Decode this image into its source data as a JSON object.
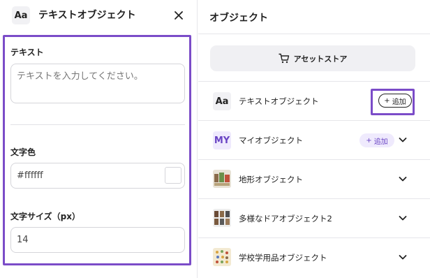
{
  "left_panel": {
    "icon_text": "Aa",
    "title": "テキストオブジェクト",
    "text_field": {
      "label": "テキスト",
      "value": "",
      "placeholder": "テキストを入力してください。"
    },
    "color_field": {
      "label": "文字色",
      "value": "#ffffff",
      "swatch_color": "#ffffff"
    },
    "size_field": {
      "label": "文字サイズ（px）",
      "value": "14"
    }
  },
  "right_panel": {
    "title": "オブジェクト",
    "store_button": "アセットストア",
    "rows": [
      {
        "icon": "Aa",
        "label": "テキストオブジェクト",
        "add_label": "追加"
      },
      {
        "icon": "MY",
        "label": "マイオブジェクト",
        "add_label": "追加"
      },
      {
        "label": "地形オブジェクト"
      },
      {
        "label": "多様なドアオブジェクト2"
      },
      {
        "label": "学校学用品オブジェクト"
      }
    ]
  },
  "colors": {
    "highlight": "#7b4cc8",
    "accent_purple": "#6a45c4",
    "my_icon_bg": "#efeafd"
  }
}
